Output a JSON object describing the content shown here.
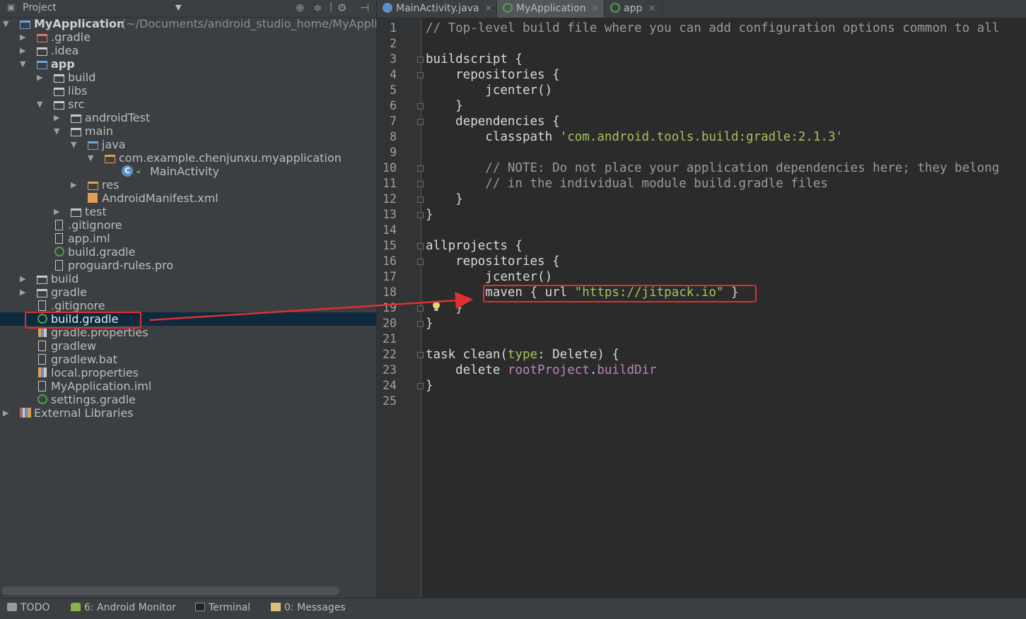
{
  "project_panel": {
    "title": "Project",
    "toolbar_icons": [
      "sync-icon",
      "collapse-icon",
      "settings-icon",
      "hide-icon"
    ]
  },
  "tree": [
    {
      "label": "MyApplication",
      "path": "(~/Documents/android_studio_home/MyAppli",
      "bold": true
    },
    {
      "label": ".gradle"
    },
    {
      "label": ".idea"
    },
    {
      "label": "app",
      "bold": true
    },
    {
      "label": "build"
    },
    {
      "label": "libs"
    },
    {
      "label": "src"
    },
    {
      "label": "androidTest"
    },
    {
      "label": "main"
    },
    {
      "label": "java"
    },
    {
      "label": "com.example.chenjunxu.myapplication"
    },
    {
      "label": "MainActivity"
    },
    {
      "label": "res"
    },
    {
      "label": "AndroidManifest.xml"
    },
    {
      "label": "test"
    },
    {
      "label": ".gitignore"
    },
    {
      "label": "app.iml"
    },
    {
      "label": "build.gradle"
    },
    {
      "label": "proguard-rules.pro"
    },
    {
      "label": "build"
    },
    {
      "label": "gradle"
    },
    {
      "label": ".gitignore"
    },
    {
      "label": "build.gradle",
      "selected": true
    },
    {
      "label": "gradle.properties"
    },
    {
      "label": "gradlew"
    },
    {
      "label": "gradlew.bat"
    },
    {
      "label": "local.properties"
    },
    {
      "label": "MyApplication.iml"
    },
    {
      "label": "settings.gradle"
    },
    {
      "label": "External Libraries"
    }
  ],
  "tabs": [
    {
      "label": "MainActivity.java",
      "icon": "class-icon",
      "active": false
    },
    {
      "label": "MyApplication",
      "icon": "gradle-icon",
      "active": true
    },
    {
      "label": "app",
      "icon": "gradle-icon",
      "active": false
    }
  ],
  "editor": {
    "line_numbers": [
      "1",
      "2",
      "3",
      "4",
      "5",
      "6",
      "7",
      "8",
      "9",
      "10",
      "11",
      "12",
      "13",
      "14",
      "15",
      "16",
      "17",
      "18",
      "19",
      "20",
      "21",
      "22",
      "23",
      "24",
      "25"
    ],
    "code": {
      "l1": "// Top-level build file where you can add configuration options common to all",
      "l3": "buildscript {",
      "l4": "    repositories {",
      "l5": "        jcenter()",
      "l6": "    }",
      "l7": "    dependencies {",
      "l8a": "        classpath ",
      "l8b": "'com.android.tools.build:gradle:2.1.3'",
      "l10": "        // NOTE: Do not place your application dependencies here; they belong",
      "l11": "        // in the individual module build.gradle files",
      "l12": "    }",
      "l13": "}",
      "l15": "allprojects {",
      "l16": "    repositories {",
      "l17": "        jcenter()",
      "l18a": "        maven { url ",
      "l18b": "\"https://jitpack.io\"",
      "l18c": " }",
      "l19": "    }",
      "l20": "}",
      "l22a": "task clean(",
      "l22b": "type",
      "l22c": ": Delete) {",
      "l23a": "    delete ",
      "l23b": "rootProject",
      "l23c": ".",
      "l23d": "buildDir",
      "l24": "}"
    }
  },
  "statusbar": {
    "todo": "TODO",
    "android_monitor": "6: Android Monitor",
    "terminal": "Terminal",
    "messages": "0: Messages"
  },
  "colors": {
    "highlight": "#e03030",
    "selection": "#0d293e",
    "string": "#a5c25c",
    "comment": "#9a9a9a"
  }
}
